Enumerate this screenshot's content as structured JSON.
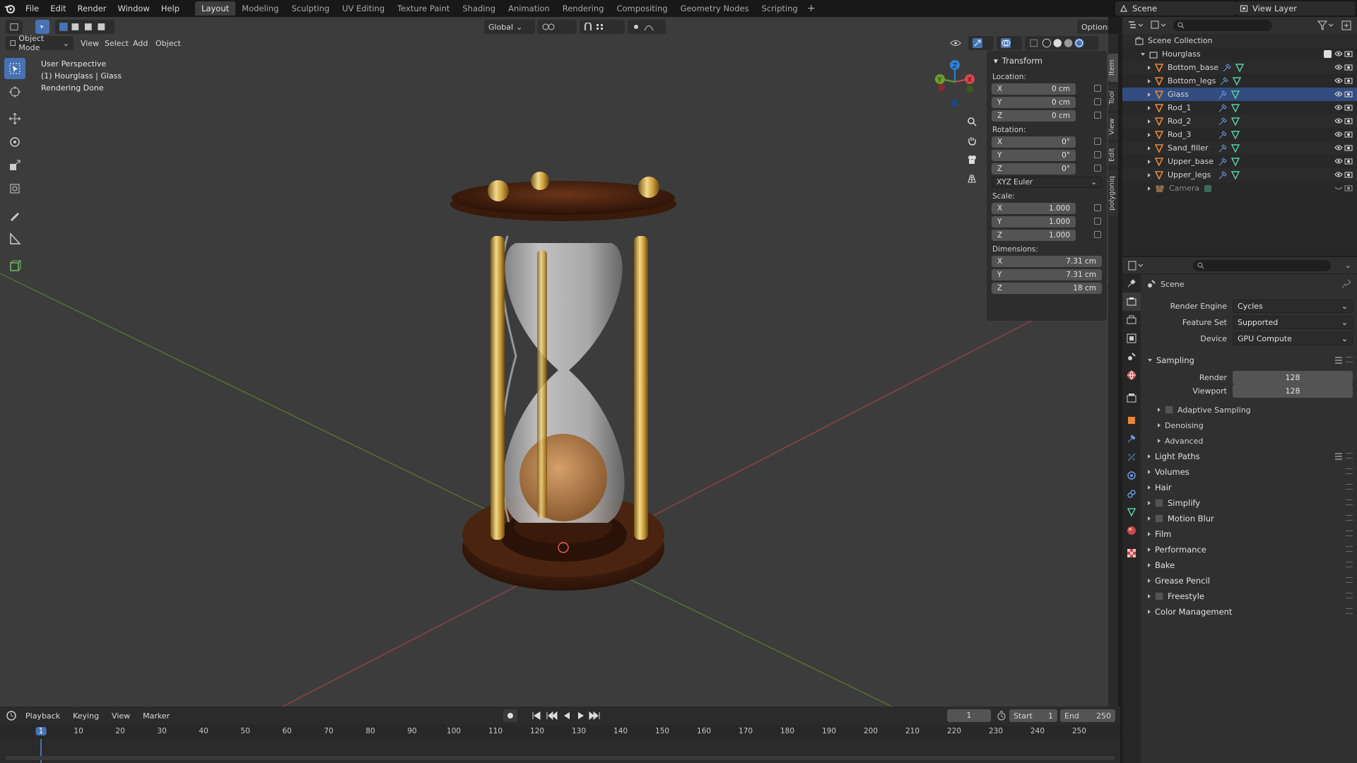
{
  "menu": {
    "file": "File",
    "edit": "Edit",
    "render": "Render",
    "window": "Window",
    "help": "Help"
  },
  "workspaces": [
    "Layout",
    "Modeling",
    "Sculpting",
    "UV Editing",
    "Texture Paint",
    "Shading",
    "Animation",
    "Rendering",
    "Compositing",
    "Geometry Nodes",
    "Scripting"
  ],
  "scene_name": "Scene",
  "view_layer": "View Layer",
  "viewport": {
    "mode": "Object Mode",
    "menus": [
      "View",
      "Select",
      "Add",
      "Object"
    ],
    "orientation": "Global",
    "options": "Options",
    "info": [
      "User Perspective",
      "(1) Hourglass | Glass",
      "Rendering Done"
    ]
  },
  "npanel": {
    "title": "Transform",
    "location_label": "Location:",
    "location": [
      {
        "axis": "X",
        "value": "0 cm"
      },
      {
        "axis": "Y",
        "value": "0 cm"
      },
      {
        "axis": "Z",
        "value": "0 cm"
      }
    ],
    "rotation_label": "Rotation:",
    "rotation": [
      {
        "axis": "X",
        "value": "0°"
      },
      {
        "axis": "Y",
        "value": "0°"
      },
      {
        "axis": "Z",
        "value": "0°"
      }
    ],
    "rotation_mode": "XYZ Euler",
    "scale_label": "Scale:",
    "scale": [
      {
        "axis": "X",
        "value": "1.000"
      },
      {
        "axis": "Y",
        "value": "1.000"
      },
      {
        "axis": "Z",
        "value": "1.000"
      }
    ],
    "dimensions_label": "Dimensions:",
    "dimensions": [
      {
        "axis": "X",
        "value": "7.31 cm"
      },
      {
        "axis": "Y",
        "value": "7.31 cm"
      },
      {
        "axis": "Z",
        "value": "18 cm"
      }
    ],
    "tabs": [
      "Item",
      "Tool",
      "View",
      "Edit",
      "polygoniq"
    ]
  },
  "outliner": {
    "root": "Scene Collection",
    "collection": "Hourglass",
    "objects": [
      "Bottom_base",
      "Bottom_legs",
      "Glass",
      "Rod_1",
      "Rod_2",
      "Rod_3",
      "Sand_filler",
      "Upper_base",
      "Upper_legs"
    ],
    "camera": "Camera"
  },
  "properties": {
    "context": "Scene",
    "render_engine_label": "Render Engine",
    "render_engine": "Cycles",
    "feature_set_label": "Feature Set",
    "feature_set": "Supported",
    "device_label": "Device",
    "device": "GPU Compute",
    "sampling": "Sampling",
    "render_label": "Render",
    "render_samples": "128",
    "viewport_label": "Viewport",
    "viewport_samples": "128",
    "subsections": [
      "Adaptive Sampling",
      "Denoising",
      "Advanced"
    ],
    "sections": [
      "Light Paths",
      "Volumes",
      "Hair",
      "Simplify",
      "Motion Blur",
      "Film",
      "Performance",
      "Bake",
      "Grease Pencil",
      "Freestyle",
      "Color Management"
    ]
  },
  "timeline": {
    "menus": [
      "Playback",
      "Keying",
      "View",
      "Marker"
    ],
    "current_frame": "1",
    "start_label": "Start",
    "start": "1",
    "end_label": "End",
    "end": "250",
    "ticks": [
      "1",
      "10",
      "20",
      "30",
      "40",
      "50",
      "60",
      "70",
      "80",
      "90",
      "100",
      "110",
      "120",
      "130",
      "140",
      "150",
      "160",
      "170",
      "180",
      "190",
      "200",
      "210",
      "220",
      "230",
      "240",
      "250"
    ]
  },
  "colors": {
    "accent": "#4772b3",
    "viewport_bg": "#3c3c3c",
    "x_axis": "#c8454f",
    "y_axis": "#6a9a2e"
  }
}
